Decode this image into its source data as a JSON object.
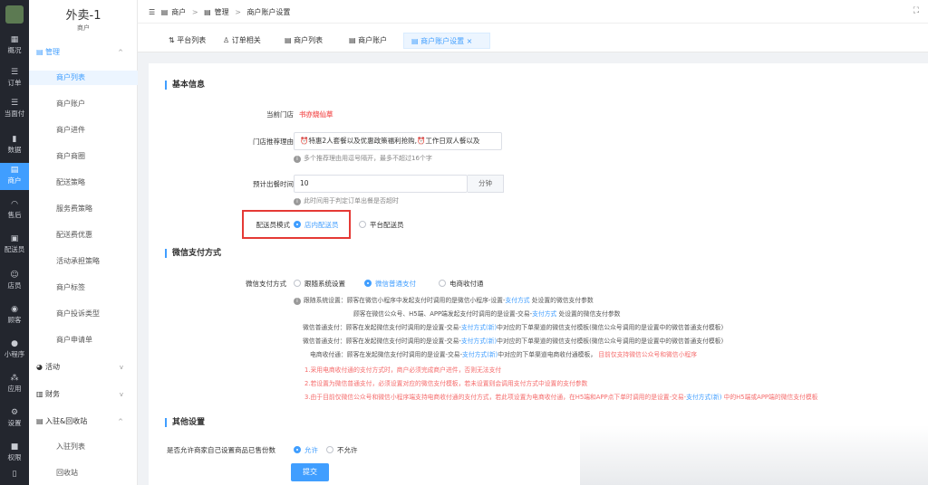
{
  "rail": {
    "items": [
      {
        "label": "概况",
        "icon": "grid-icon"
      },
      {
        "label": "订单",
        "icon": "list-icon"
      },
      {
        "label": "当面付",
        "icon": "list-icon"
      },
      {
        "label": "数据",
        "icon": "chart-icon"
      },
      {
        "label": "商户",
        "icon": "store-icon"
      },
      {
        "label": "售后",
        "icon": "headset-icon"
      },
      {
        "label": "配送员",
        "icon": "truck-icon"
      },
      {
        "label": "店员",
        "icon": "users-icon"
      },
      {
        "label": "顾客",
        "icon": "user-icon"
      },
      {
        "label": "小程序",
        "icon": "wechat-icon"
      },
      {
        "label": "应用",
        "icon": "apps-icon"
      },
      {
        "label": "设置",
        "icon": "gear-icon"
      },
      {
        "label": "权限",
        "icon": "lock-icon"
      },
      {
        "label": "",
        "icon": "doc-icon"
      }
    ]
  },
  "menu": {
    "store_name": "外卖-1",
    "store_sub": "商户",
    "group_manage": "管理",
    "items": [
      "商户列表",
      "商户账户",
      "商户进件",
      "商户商圈",
      "配送策略",
      "服务费策略",
      "配送费优惠",
      "活动承担策略",
      "商户标签",
      "商户投诉类型",
      "商户申请单"
    ],
    "group_activity": "活动",
    "group_finance": "财务",
    "group_settle": "入驻&回收站",
    "settle_items": [
      "入驻列表",
      "回收站"
    ]
  },
  "breadcrumb": [
    "商户",
    "管理",
    "商户账户设置"
  ],
  "tabs": [
    "平台列表",
    "订单相关",
    "商户列表",
    "商户账户",
    "商户账户设置"
  ],
  "basic": {
    "title": "基本信息",
    "store_label": "当前门店",
    "store_value": "书亦烧仙草",
    "reason_label": "门店推荐理由",
    "reason_value": "⏰特惠2人套餐以及优惠政策福利抢购,⏰工作日双人餐以及",
    "reason_hint": "多个推荐理由用逗号隔开，最多不超过16个字",
    "time_label": "预计出餐时间",
    "time_value": "10",
    "time_unit": "分钟",
    "time_hint": "此时间用于判定订单出餐是否超时",
    "delivery_label": "配送员模式",
    "delivery_opt1": "店内配送员",
    "delivery_opt2": "平台配送员"
  },
  "pay": {
    "title": "微信支付方式",
    "label": "微信支付方式",
    "opt1": "跟随系统设置",
    "opt2": "微信普通支付",
    "opt3": "电商收付通",
    "n1a": "跟随系统设置：",
    "n1b": "顾客在微信小程序中发起支付时调用的是微信小程序-设置-",
    "n1c": "支付方式",
    "n1d": "处设置的微信支付参数",
    "n2a": "顾客在微信公众号、H5端、APP端发起支付时调用的是设置-交易-",
    "n2b": "支付方式",
    "n2c": "处设置的微信支付参数",
    "n3a": "微信普通支付：",
    "n3b": "顾客在发起微信支付时调用的是设置-交易-",
    "n3c": "支付方式(新)",
    "n3d": "中对应的下单渠道的微信支付模板(微信公众号调用的是设置中的微信普通支付模板)",
    "n4a": "微信普通支付：",
    "n4b": "顾客在发起微信支付时调用的是设置-交易-",
    "n4c": "支付方式(新)",
    "n4d": "中对应的下单渠道的微信支付模板(微信公众号调用的是设置中的微信普通支付模板)",
    "n5a": "电商收付通：",
    "n5b": "顾客在发起微信支付时调用的是设置-交易-",
    "n5c": "支付方式(新)",
    "n5d": "中对应的下单渠道电商收付通模板，",
    "n5e": "目前仅支持微信公众号和微信小程序",
    "r1": "1.采用电商收付通的支付方式时，商户必须完成商户进件，否则无法支付",
    "r2": "2.若设置为微信普通支付，必须设置对应的微信支付模板，若未设置则会调用支付方式中设置的支付参数",
    "r3a": "3.由于目前仅微信公众号和微信小程序端支持电商收付通的支付方式，若此项设置为电商收付通，在H5端和APP点下单时调用的是设置-交易-",
    "r3b": "支付方式(新)",
    "r3c": "中的H5端或APP端的微信支付模板"
  },
  "other": {
    "title": "其他设置",
    "label": "是否允许商家自己设置商品已售份数",
    "opt1": "允许",
    "opt2": "不允许",
    "submit": "提交"
  },
  "colors": {
    "accent": "#409eff",
    "rail_bg": "#23262e",
    "warn": "#f56c6c",
    "highlight_box": "#e53935"
  }
}
